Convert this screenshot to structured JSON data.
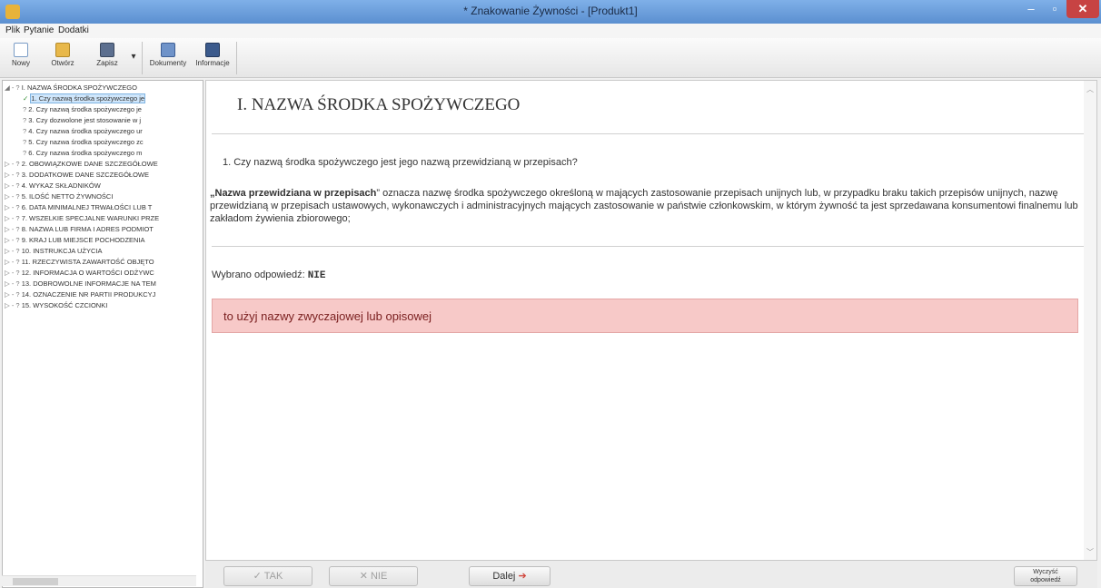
{
  "window": {
    "title": "* Znakowanie Żywności - [Produkt1]",
    "min_glyph": "–",
    "max_glyph": "▫",
    "close_glyph": "✕"
  },
  "menu": [
    "Plik",
    "Pytanie",
    "Dodatki"
  ],
  "toolbar": {
    "new": "Nowy",
    "open": "Otwórz",
    "save": "Zapisz",
    "dropdown_glyph": "▾",
    "documents": "Dokumenty",
    "info": "Informacje"
  },
  "tree": [
    {
      "mark": "◢ - ?",
      "text": "I. NAZWA ŚRODKA SPOŻYWCZEGO"
    },
    {
      "mark": "✓",
      "text": "1. Czy nazwą środka spożywczego je"
    },
    {
      "mark": "?",
      "text": "2. Czy nazwą środka spożywczego je"
    },
    {
      "mark": "?",
      "text": "3. Czy dozwolone jest stosowanie w j"
    },
    {
      "mark": "?",
      "text": "4. Czy nazwa środka spożywczego ur"
    },
    {
      "mark": "?",
      "text": "5. Czy nazwa środka spożywczego zc"
    },
    {
      "mark": "?",
      "text": "6. Czy nazwa środka spożywczego m"
    },
    {
      "mark": "▷ - ?",
      "text": "2. OBOWIĄZKOWE DANE SZCZEGÓŁOWE"
    },
    {
      "mark": "▷ - ?",
      "text": "3. DODATKOWE DANE SZCZEGÓŁOWE"
    },
    {
      "mark": "▷ - ?",
      "text": "4. WYKAZ SKŁADNIKÓW"
    },
    {
      "mark": "▷ - ?",
      "text": "5. ILOŚĆ NETTO ŻYWNOŚCI"
    },
    {
      "mark": "▷ - ?",
      "text": "6. DATA MINIMALNEJ TRWAŁOŚCI LUB T"
    },
    {
      "mark": "▷ - ?",
      "text": "7. WSZELKIE SPECJALNE WARUNKI PRZE"
    },
    {
      "mark": "▷ - ?",
      "text": "8. NAZWA LUB FIRMA I ADRES PODMIOT"
    },
    {
      "mark": "▷ - ?",
      "text": "9. KRAJ LUB MIEJSCE POCHODZENIA"
    },
    {
      "mark": "▷ - ?",
      "text": "10. INSTRUKCJA UŻYCIA"
    },
    {
      "mark": "▷ - ?",
      "text": "11. RZECZYWISTA ZAWARTOŚĆ OBJĘTO"
    },
    {
      "mark": "▷ - ?",
      "text": "12. INFORMACJA O WARTOŚCI ODŻYWC"
    },
    {
      "mark": "▷ - ?",
      "text": "13. DOBROWOLNE INFORMACJE NA TEM"
    },
    {
      "mark": "▷ - ?",
      "text": "14. OZNACZENIE NR PARTII PRODUKCYJ"
    },
    {
      "mark": "▷ - ?",
      "text": "15. WYSOKOŚĆ CZCIONKI"
    }
  ],
  "content": {
    "heading": "I. NAZWA ŚRODKA SPOŻYWCZEGO",
    "question": "1.  Czy nazwą środka spożywczego jest jego nazwą przewidzianą w przepisach?",
    "definition_term": "„Nazwa przewidziana w przepisach",
    "definition_text": "” oznacza nazwę środka spożywczego określoną w mających zastosowanie przepisach unijnych lub, w przypadku braku takich przepisów unijnych, nazwę przewidzianą w przepisach ustawowych, wykonawczych i administracyjnych mających zastosowanie w państwie członkowskim, w którym żywność ta jest sprzedawana konsumentowi finalnemu lub zakładom żywienia zbiorowego;",
    "answer_label": "Wybrano odpowiedź:",
    "answer_value": "NIE",
    "alert": "to użyj nazwy zwyczajowej lub opisowej"
  },
  "buttons": {
    "yes": "TAK",
    "no": "NIE",
    "next": "Dalej",
    "clear_line1": "Wyczyść",
    "clear_line2": "odpowiedź"
  }
}
